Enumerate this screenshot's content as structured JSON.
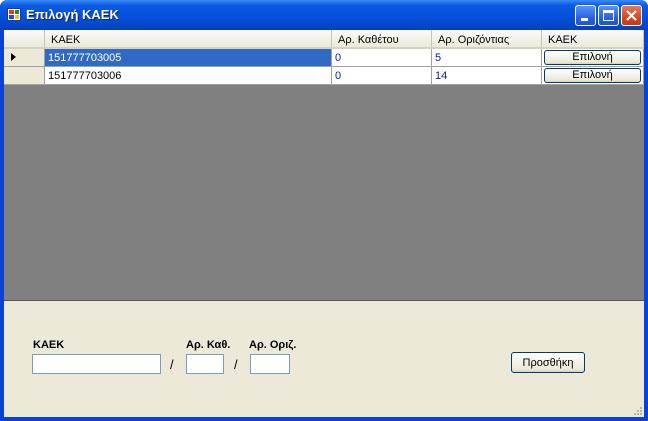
{
  "window": {
    "title": "Επιλογή ΚΑΕΚ"
  },
  "grid": {
    "columns": [
      "ΚΑΕΚ",
      "Αρ. Καθέτου",
      "Αρ. Οριζόντιας",
      "ΚΑΕΚ"
    ],
    "rows": [
      {
        "kaek": "151777703005",
        "kathetou": "0",
        "orizontias": "5",
        "action": "Επιλονή",
        "current": true
      },
      {
        "kaek": "151777703006",
        "kathetou": "0",
        "orizontias": "14",
        "action": "Επιλονή",
        "current": false
      }
    ]
  },
  "form": {
    "kaek_label": "ΚΑΕΚ",
    "kath_label": "Αρ. Καθ.",
    "oriz_label": "Αρ. Οριζ.",
    "separator": "/",
    "kaek_value": "",
    "kath_value": "",
    "oriz_value": "",
    "add_label": "Προσθήκη"
  },
  "colors": {
    "title_bar": "#0550dc",
    "selection": "#316ac5",
    "grid_background": "#808080",
    "dialog_background": "#ece9d8"
  }
}
